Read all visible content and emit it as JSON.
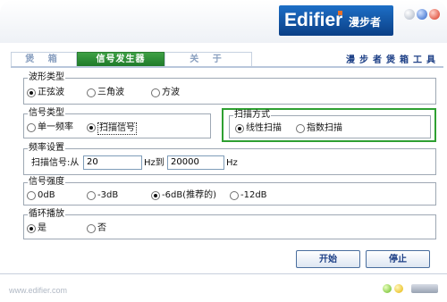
{
  "header": {
    "logo_en": "Edifier",
    "logo_cn": "漫步者"
  },
  "tabs": [
    {
      "label": "煲 箱",
      "active": false
    },
    {
      "label": "信号发生器",
      "active": true
    },
    {
      "label": "关 于",
      "active": false
    }
  ],
  "brand_title": "漫步者煲箱工具",
  "waveform": {
    "legend": "波形类型",
    "options": [
      "正弦波",
      "三角波",
      "方波"
    ],
    "selected": "正弦波"
  },
  "signal_type": {
    "legend": "信号类型",
    "options": [
      "单一频率",
      "扫描信号"
    ],
    "selected": "扫描信号"
  },
  "scan_mode": {
    "legend": "扫描方式",
    "options": [
      "线性扫描",
      "指数扫描"
    ],
    "selected": "线性扫描"
  },
  "frequency": {
    "legend": "频率设置",
    "label": "扫描信号:从",
    "from_value": "20",
    "to_label": "Hz到",
    "to_value": "20000",
    "unit": "Hz"
  },
  "strength": {
    "legend": "信号强度",
    "options": [
      "0dB",
      "-3dB",
      "-6dB(推荐的)",
      "-12dB"
    ],
    "selected": "-6dB(推荐的)"
  },
  "loop": {
    "legend": "循环播放",
    "options": [
      "是",
      "否"
    ],
    "selected": "是"
  },
  "buttons": {
    "start": "开始",
    "stop": "停止"
  },
  "footer": {
    "url": "www.edifier.com"
  },
  "colors": {
    "accent_green": "#2fa032",
    "brand_blue": "#1c3f86"
  }
}
